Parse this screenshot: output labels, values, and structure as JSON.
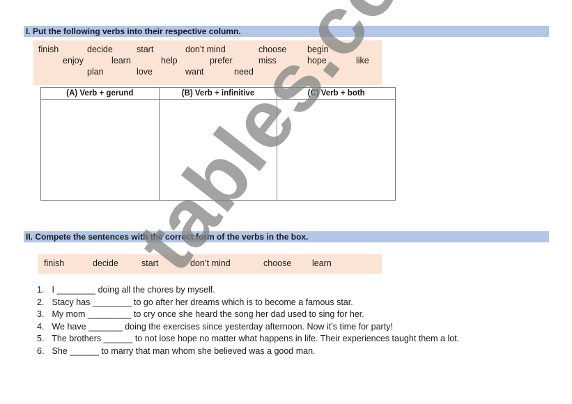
{
  "section1": {
    "title": "I. Put the following verbs into their respective column.",
    "verb_rows": [
      [
        "finish",
        "decide",
        "start",
        "don’t mind",
        "choose",
        "begin"
      ],
      [
        "enjoy",
        "learn",
        "help",
        "prefer",
        "miss",
        "hope",
        "like"
      ],
      [
        "plan",
        "love",
        "want",
        "need"
      ]
    ],
    "table": {
      "headers": [
        "(A) Verb + gerund",
        "(B) Verb + infinitive",
        "(C) Verb + both"
      ]
    }
  },
  "section2": {
    "title": "II. Compete the sentences with the correct form of the verbs in the box.",
    "verbs": [
      "finish",
      "decide",
      "start",
      "don’t mind",
      "choose",
      "learn"
    ],
    "sentences": [
      {
        "num": "1.",
        "before": "I",
        "blank": "________",
        "after": "doing all the chores by myself."
      },
      {
        "num": "2.",
        "before": "Stacy has",
        "blank": "________",
        "after": "to go after her dreams which is to become a famous star."
      },
      {
        "num": "3.",
        "before": "My mom",
        "blank": "_________",
        "after": "to cry once she heard the song her dad used to sing for her."
      },
      {
        "num": "4.",
        "before": "We have",
        "blank": "_______",
        "after": "doing the exercises since yesterday afternoon. Now it’s time for party!"
      },
      {
        "num": "5.",
        "before": "The brothers",
        "blank": "______",
        "after": "to not lose hope no matter what happens in life. Their experiences taught them a lot."
      },
      {
        "num": "6.",
        "before": "She",
        "blank": "______",
        "after": "to marry that man whom she believed was a good man."
      }
    ]
  },
  "watermark": "tables.com",
  "colors": {
    "header_bar": "#b4c6e7",
    "verb_box": "#fbe4d5"
  }
}
